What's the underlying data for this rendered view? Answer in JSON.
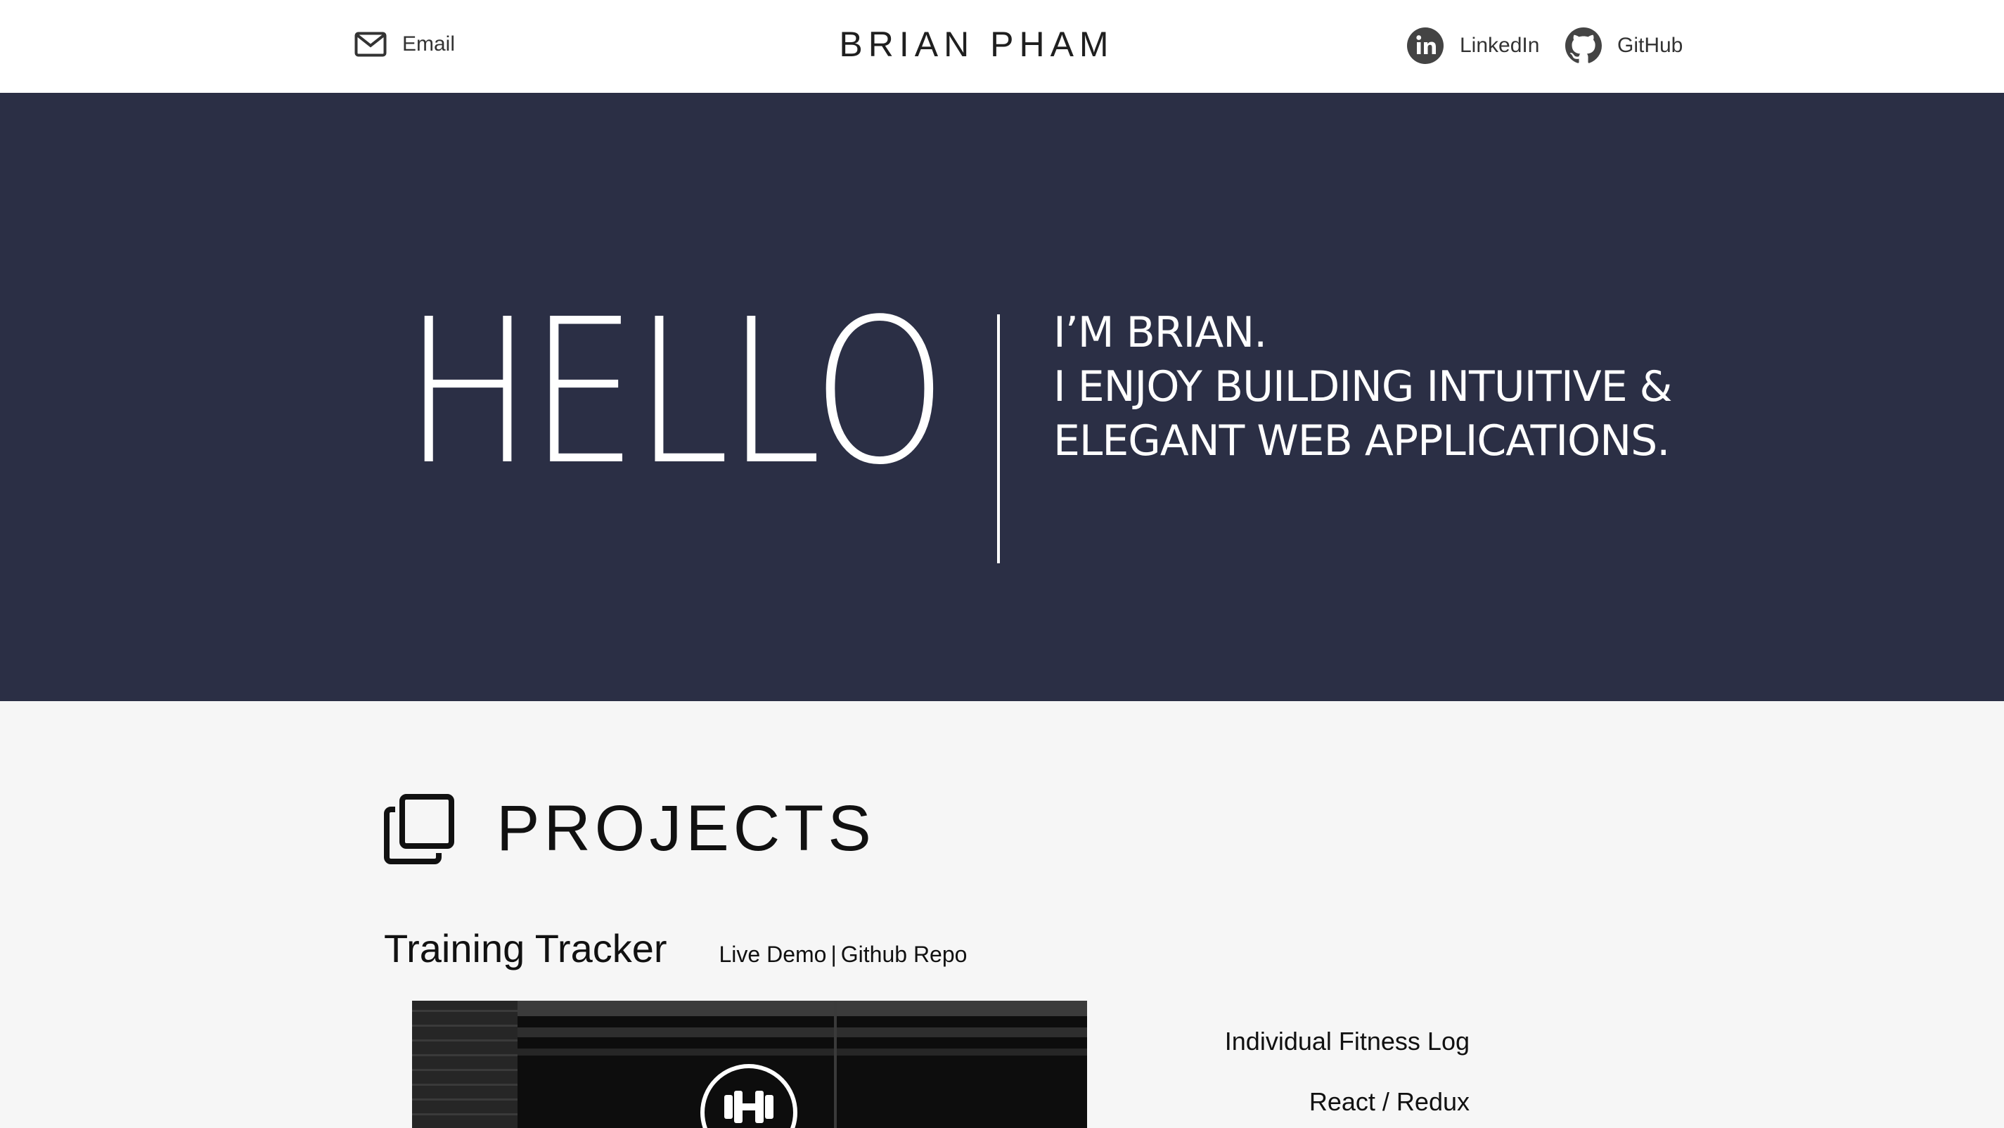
{
  "nav": {
    "email_label": "Email",
    "brand": "BRIAN PHAM",
    "linkedin_label": "LinkedIn",
    "github_label": "GitHub"
  },
  "hero": {
    "hello": "HELLO",
    "tagline": [
      "I’M BRIAN.",
      "I ENJOY BUILDING INTUITIVE &",
      "ELEGANT WEB APPLICATIONS."
    ]
  },
  "projects": {
    "title": "PROJECTS",
    "items": [
      {
        "name": "Training Tracker",
        "live_demo_label": "Live Demo",
        "separator": "|",
        "repo_label": "Github Repo",
        "description": "Individual Fitness Log",
        "stack": "React / Redux"
      }
    ]
  },
  "colors": {
    "hero_bg": "#2b2f45",
    "page_bg": "#f6f6f6",
    "nav_bg": "#ffffff",
    "text": "#111111"
  },
  "icons": {
    "email": "envelope-icon",
    "linkedin": "linkedin-icon",
    "github": "github-icon",
    "projects": "stacked-squares-icon",
    "project_logo": "dumbbell-icon"
  }
}
